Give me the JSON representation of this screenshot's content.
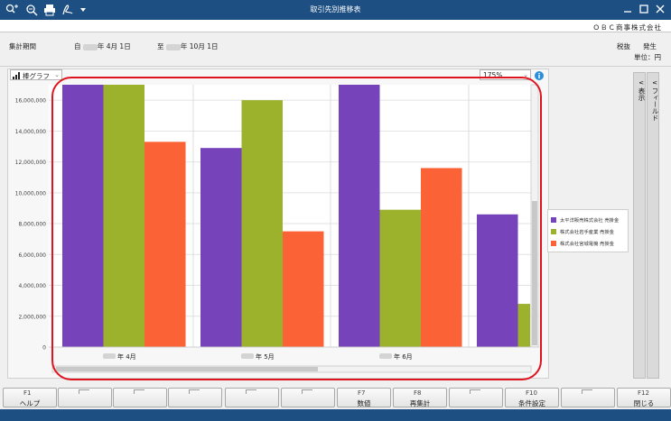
{
  "window": {
    "title": "取引先別推移表",
    "company": "ＯＢＣ商事株式会社"
  },
  "toolbar": {
    "icons": [
      "zoom-in-icon",
      "zoom-search-icon",
      "print-icon",
      "pdf-export-icon",
      "dropdown-icon"
    ]
  },
  "header": {
    "period_label": "集計期間",
    "from_prefix": "自",
    "from_suffix": "年  4月 1日",
    "to_prefix": "至",
    "to_suffix": "年 10月 1日",
    "tax_label": "税抜",
    "basis_label": "発生",
    "unit_label": "単位：円"
  },
  "controls": {
    "chart_type": "棒グラフ",
    "zoom": "175%"
  },
  "side_tabs": {
    "display": "表示",
    "field": "フィールド"
  },
  "chart_data": {
    "type": "bar",
    "categories": [
      "年  4月",
      "年  5月",
      "年  6月",
      ""
    ],
    "series": [
      {
        "name": "太平洋販売株式会社 売掛金",
        "color": "#7743bb",
        "values": [
          17000000,
          12900000,
          17000000,
          8600000
        ]
      },
      {
        "name": "株式会社岩手産業 売掛金",
        "color": "#9db22c",
        "values": [
          17000000,
          16000000,
          8900000,
          2800000
        ]
      },
      {
        "name": "株式会社宮城電機 売掛金",
        "color": "#fb6236",
        "values": [
          13300000,
          7500000,
          11600000,
          null
        ]
      }
    ],
    "yticks": [
      "0",
      "2,000,000",
      "4,000,000",
      "6,000,000",
      "8,000,000",
      "10,000,000",
      "12,000,000",
      "14,000,000",
      "16,000,000"
    ],
    "ylim": [
      0,
      17000000
    ],
    "grid": true,
    "legend": "right"
  },
  "fkeys": [
    {
      "key": "F1",
      "label": "ヘルプ"
    },
    {
      "key": "",
      "label": ""
    },
    {
      "key": "",
      "label": ""
    },
    {
      "key": "",
      "label": ""
    },
    {
      "key": "",
      "label": ""
    },
    {
      "key": "",
      "label": ""
    },
    {
      "key": "F7",
      "label": "数値"
    },
    {
      "key": "F8",
      "label": "再集計"
    },
    {
      "key": "",
      "label": ""
    },
    {
      "key": "F10",
      "label": "条件設定"
    },
    {
      "key": "",
      "label": ""
    },
    {
      "key": "F12",
      "label": "閉じる"
    }
  ]
}
